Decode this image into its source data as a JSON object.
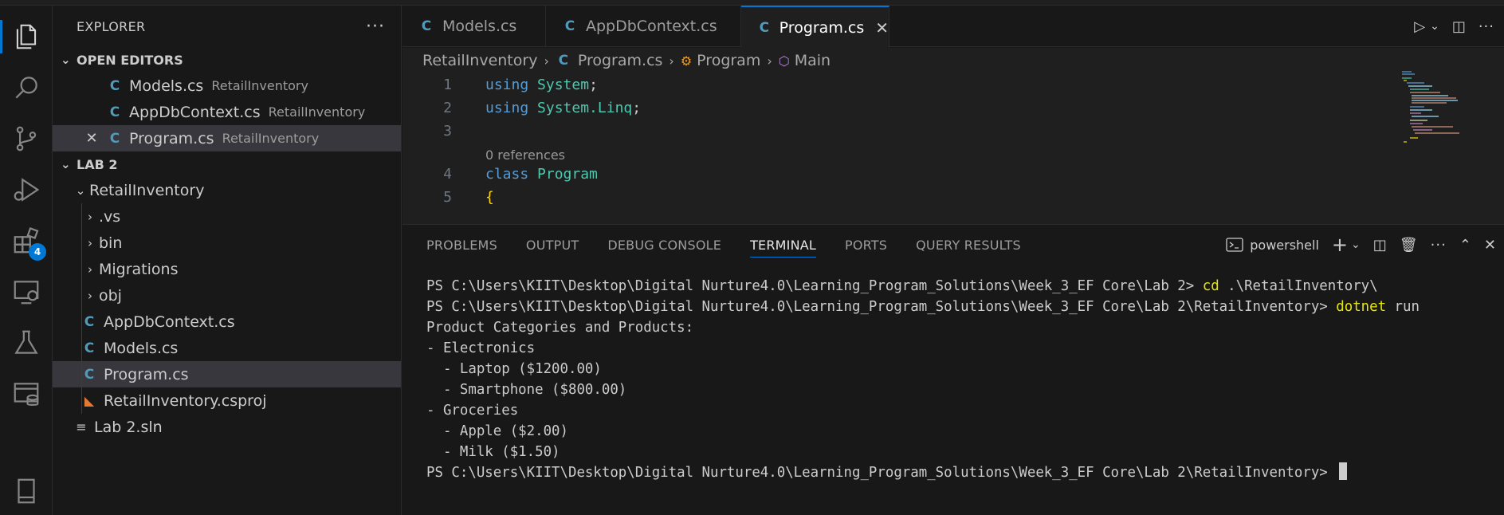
{
  "activity_bar": {
    "items": [
      {
        "name": "explorer-icon",
        "active": true
      },
      {
        "name": "search-icon"
      },
      {
        "name": "source-control-icon"
      },
      {
        "name": "run-debug-icon"
      },
      {
        "name": "extensions-icon",
        "badge": "4"
      },
      {
        "name": "remote-explorer-icon"
      },
      {
        "name": "testing-icon"
      },
      {
        "name": "database-icon"
      },
      {
        "name": "bookmark-icon"
      }
    ]
  },
  "sidebar": {
    "title": "EXPLORER",
    "more": "···",
    "open_editors": {
      "label": "OPEN EDITORS",
      "items": [
        {
          "name": "Models.cs",
          "desc": "RetailInventory"
        },
        {
          "name": "AppDbContext.cs",
          "desc": "RetailInventory"
        },
        {
          "name": "Program.cs",
          "desc": "RetailInventory"
        }
      ]
    },
    "workspace": {
      "label": "LAB 2",
      "project": "RetailInventory",
      "folders": [
        ".vs",
        "bin",
        "Migrations",
        "obj"
      ],
      "files": [
        "AppDbContext.cs",
        "Models.cs",
        "Program.cs",
        "RetailInventory.csproj"
      ],
      "solution": "Lab 2.sln"
    }
  },
  "tabs": {
    "items": [
      {
        "label": "Models.cs"
      },
      {
        "label": "AppDbContext.cs"
      },
      {
        "label": "Program.cs"
      }
    ]
  },
  "breadcrumb": {
    "items": [
      "RetailInventory",
      "Program.cs",
      "Program",
      "Main"
    ]
  },
  "editor": {
    "lines": [
      {
        "num": "1",
        "kw": "using",
        "rest": "System",
        "end": ";"
      },
      {
        "num": "2",
        "kw": "using",
        "rest": "System.Linq",
        "end": ";"
      },
      {
        "num": "3"
      },
      {
        "codelens": "0 references"
      },
      {
        "num": "4",
        "kw": "class",
        "rest": "Program"
      },
      {
        "num": "5",
        "brace": "{"
      }
    ]
  },
  "panel": {
    "tabs": [
      "PROBLEMS",
      "OUTPUT",
      "DEBUG CONSOLE",
      "TERMINAL",
      "PORTS",
      "QUERY RESULTS"
    ],
    "active_tab": "TERMINAL",
    "shell": "powershell",
    "terminal": {
      "prompt1": "PS C:\\Users\\KIIT\\Desktop\\Digital Nurture4.0\\Learning_Program_Solutions\\Week_3_EF Core\\Lab 2> ",
      "cmd1_a": "cd",
      "cmd1_b": " .\\RetailInventory\\",
      "prompt2": "PS C:\\Users\\KIIT\\Desktop\\Digital Nurture4.0\\Learning_Program_Solutions\\Week_3_EF Core\\Lab 2\\RetailInventory> ",
      "cmd2_a": "dotnet",
      "cmd2_b": " run",
      "output": [
        "Product Categories and Products:",
        "- Electronics",
        "  - Laptop ($1200.00)",
        "  - Smartphone ($800.00)",
        "- Groceries",
        "  - Apple ($2.00)",
        "  - Milk ($1.50)"
      ],
      "prompt3": "PS C:\\Users\\KIIT\\Desktop\\Digital Nurture4.0\\Learning_Program_Solutions\\Week_3_EF Core\\Lab 2\\RetailInventory> "
    }
  },
  "colors": {
    "accent": "#0078d4",
    "keyword": "#569cd6",
    "type": "#4ec9b0",
    "csharp_icon": "#519aba",
    "command": "#e5e510"
  }
}
